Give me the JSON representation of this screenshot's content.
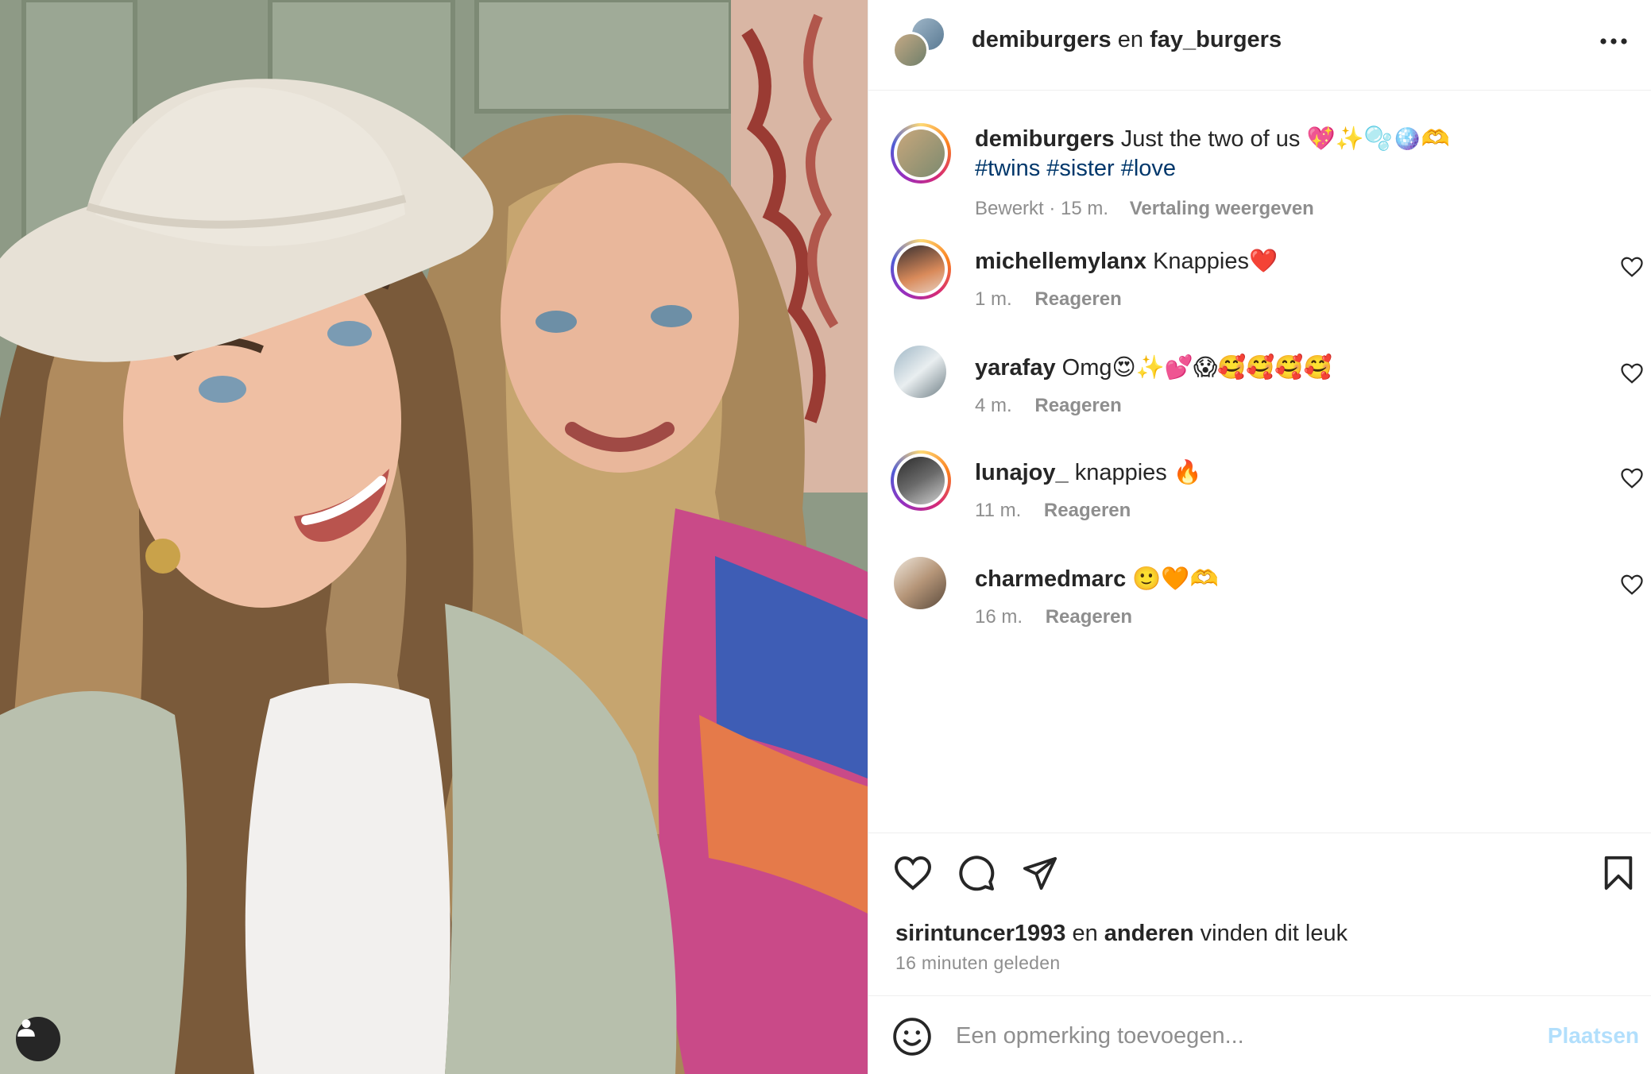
{
  "header": {
    "user1": "demiburgers",
    "conjunction": "en",
    "user2": "fay_burgers",
    "more_icon": "more-horizontal-icon"
  },
  "caption": {
    "username": "demiburgers",
    "text": "Just the two of us 💖✨🫧🪩🫶",
    "hashtags": "#twins #sister #love",
    "edited": "Bewerkt · 15 m.",
    "translate": "Vertaling weergeven"
  },
  "comments": [
    {
      "username": "michellemylanx",
      "text": "Knappies❤️",
      "time": "1 m.",
      "reply": "Reageren"
    },
    {
      "username": "yarafay",
      "text": "Omg😍✨💕😱🥰🥰🥰🥰",
      "time": "4 m.",
      "reply": "Reageren"
    },
    {
      "username": "lunajoy_",
      "text": "knappies 🔥",
      "time": "11 m.",
      "reply": "Reageren"
    },
    {
      "username": "charmedmarc",
      "text": "🙂🧡🫶",
      "time": "16 m.",
      "reply": "Reageren"
    }
  ],
  "likes": {
    "user": "sirintuncer1993",
    "conjunction": "en",
    "others": "anderen",
    "suffix": "vinden dit leuk"
  },
  "posted": "16 minuten geleden",
  "composer": {
    "placeholder": "Een opmerking toevoegen...",
    "post_label": "Plaatsen"
  },
  "colors": {
    "text": "#262626",
    "secondary": "#8e8e8e",
    "link": "#00376b",
    "post_disabled": "#b2dffc",
    "border": "#efefef"
  }
}
